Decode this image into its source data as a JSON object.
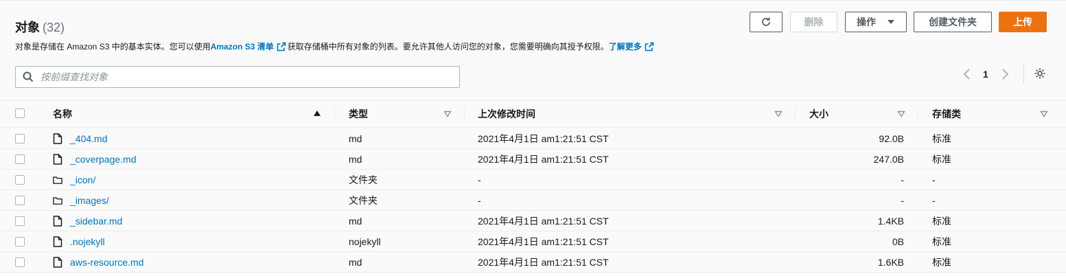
{
  "header": {
    "title": "对象",
    "count": "(32)",
    "description": {
      "part1": "对象是存储在 Amazon S3 中的基本实体。您可以使用 ",
      "inventory_link": "Amazon S3 清单",
      "part2": "获取存储桶中所有对象的列表。要允许其他人访问您的对象，您需要明确向其授予权限。",
      "learn_more_link": "了解更多"
    }
  },
  "toolbar": {
    "refresh_icon": "refresh-icon",
    "delete_label": "删除",
    "actions_label": "操作",
    "create_folder_label": "创建文件夹",
    "upload_label": "上传"
  },
  "search": {
    "placeholder": "按前缀查找对象",
    "value": ""
  },
  "pagination": {
    "current_page": "1"
  },
  "table": {
    "columns": [
      "名称",
      "类型",
      "上次修改时间",
      "大小",
      "存储类"
    ],
    "rows": [
      {
        "name": "_404.md",
        "kind": "file",
        "type": "md",
        "modified": "2021年4月1日 am1:21:51 CST",
        "size": "92.0B",
        "storage": "标准"
      },
      {
        "name": "_coverpage.md",
        "kind": "file",
        "type": "md",
        "modified": "2021年4月1日 am1:21:51 CST",
        "size": "247.0B",
        "storage": "标准"
      },
      {
        "name": "_icon/",
        "kind": "folder",
        "type": "文件夹",
        "modified": "-",
        "size": "-",
        "storage": "-"
      },
      {
        "name": "_images/",
        "kind": "folder",
        "type": "文件夹",
        "modified": "-",
        "size": "-",
        "storage": "-"
      },
      {
        "name": "_sidebar.md",
        "kind": "file",
        "type": "md",
        "modified": "2021年4月1日 am1:21:51 CST",
        "size": "1.4KB",
        "storage": "标准"
      },
      {
        "name": ".nojekyll",
        "kind": "file",
        "type": "nojekyll",
        "modified": "2021年4月1日 am1:21:51 CST",
        "size": "0B",
        "storage": "标准"
      },
      {
        "name": "aws-resource.md",
        "kind": "file",
        "type": "md",
        "modified": "2021年4月1日 am1:21:51 CST",
        "size": "1.6KB",
        "storage": "标准"
      }
    ]
  },
  "colors": {
    "accent": "#ec7211",
    "link": "#0073bb",
    "text": "#16191f",
    "muted": "#687078"
  }
}
